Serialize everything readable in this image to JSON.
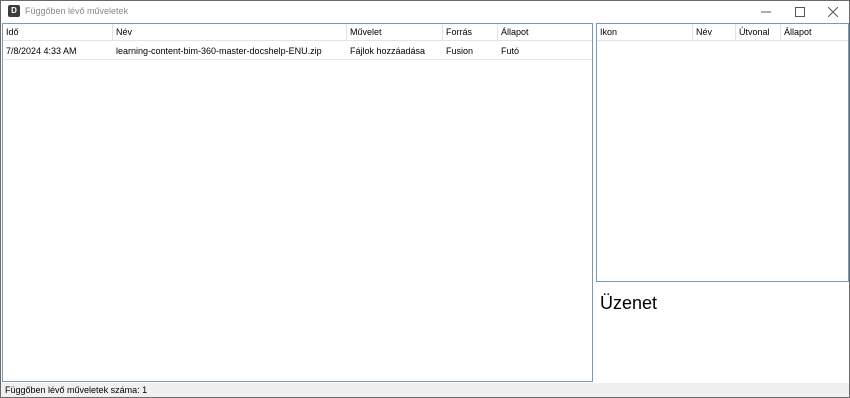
{
  "window": {
    "title": "Függőben lévő műveletek",
    "app_icon_letter": "D"
  },
  "operations_table": {
    "columns": [
      "Idő",
      "Név",
      "Művelet",
      "Forrás",
      "Állapot"
    ],
    "rows": [
      [
        "7/8/2024 4:33 AM",
        "learning-content-bim-360-master-docshelp-ENU.zip",
        "Fájlok hozzáadása",
        "Fusion",
        "Futó"
      ]
    ]
  },
  "details_table": {
    "columns": [
      "Ikon",
      "Név",
      "Útvonal",
      "Állapot"
    ],
    "rows": []
  },
  "message_panel": {
    "title": "Üzenet"
  },
  "statusbar": {
    "text": "Függőben lévő műveletek száma: 1"
  }
}
